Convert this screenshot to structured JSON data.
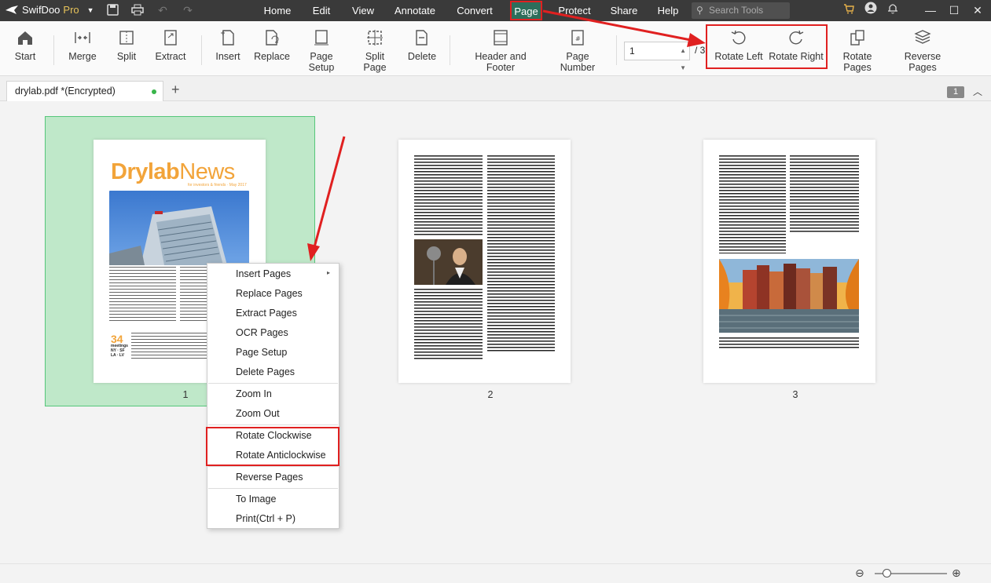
{
  "app": {
    "name": "SwifDoo",
    "edition": "Pro"
  },
  "menus": [
    "Home",
    "Edit",
    "View",
    "Annotate",
    "Convert",
    "Page",
    "Protect",
    "Share",
    "Help"
  ],
  "active_menu": "Page",
  "search": {
    "placeholder": "Search Tools"
  },
  "toolbar": {
    "start": "Start",
    "merge": "Merge",
    "split": "Split",
    "extract": "Extract",
    "insert": "Insert",
    "replace": "Replace",
    "page_setup": "Page Setup",
    "split_page": "Split Page",
    "delete": "Delete",
    "header_footer": "Header and Footer",
    "page_number": "Page Number",
    "page_value": "1",
    "page_total": "/ 3",
    "rotate_left": "Rotate Left",
    "rotate_right": "Rotate Right",
    "rotate_pages": "Rotate Pages",
    "reverse_pages": "Reverse Pages"
  },
  "tab": {
    "title": "drylab.pdf *(Encrypted)"
  },
  "page_indicator": "1",
  "pages": [
    {
      "label": "1"
    },
    {
      "label": "2"
    },
    {
      "label": "3"
    }
  ],
  "thumb1": {
    "brand_a": "Drylab",
    "brand_b": "News",
    "subtitle": "for investors & friends · May 2017",
    "stat": "34",
    "stat_caption": "meetings",
    "stat_cities": "NY · SF",
    "stat_cities2": "LA · LV"
  },
  "context_menu": {
    "insert_pages": "Insert Pages",
    "replace_pages": "Replace Pages",
    "extract_pages": "Extract Pages",
    "ocr_pages": "OCR Pages",
    "page_setup": "Page Setup",
    "delete_pages": "Delete Pages",
    "zoom_in": "Zoom In",
    "zoom_out": "Zoom Out",
    "rotate_clockwise": "Rotate Clockwise",
    "rotate_anticlockwise": "Rotate Anticlockwise",
    "reverse_pages": "Reverse Pages",
    "to_image": "To Image",
    "print": "Print(Ctrl + P)"
  },
  "colors": {
    "accent_green": "#2d6e5b",
    "annotation_red": "#e02020",
    "brand_orange": "#f2a43a"
  }
}
